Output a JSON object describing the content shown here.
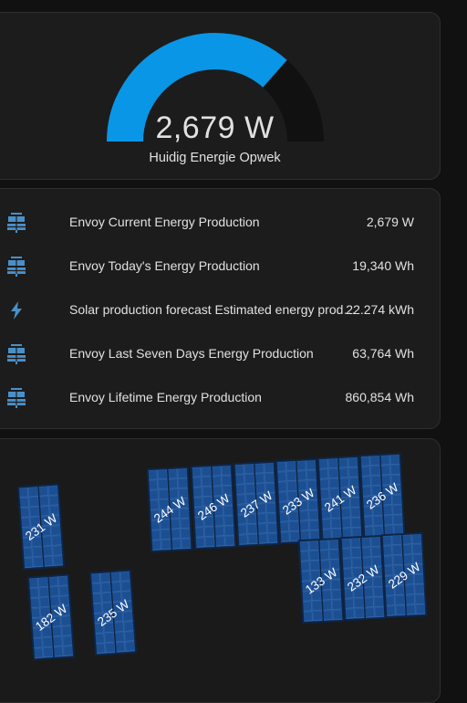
{
  "gauge": {
    "value": "2,679 W",
    "label": "Huidig Energie Opwek",
    "fill_fraction": 0.73,
    "color": "#0996e6",
    "track_color": "#111111"
  },
  "entities": [
    {
      "icon": "solar-power-icon",
      "name": "Envoy Current Energy Production",
      "value": "2,679 W"
    },
    {
      "icon": "solar-power-icon",
      "name": "Envoy Today's Energy Production",
      "value": "19,340 Wh"
    },
    {
      "icon": "flash-icon",
      "name": "Solar production forecast Estimated energy production - this hour",
      "value": "22.274 kWh"
    },
    {
      "icon": "solar-power-icon",
      "name": "Envoy Last Seven Days Energy Production",
      "value": "63,764 Wh"
    },
    {
      "icon": "solar-power-icon",
      "name": "Envoy Lifetime Energy Production",
      "value": "860,854 Wh"
    }
  ],
  "icon_color": "#4a90c8",
  "panels": [
    {
      "value": "231 W"
    },
    {
      "value": "182 W"
    },
    {
      "value": "235 W"
    },
    {
      "value": "244 W"
    },
    {
      "value": "246 W"
    },
    {
      "value": "237 W"
    },
    {
      "value": "233 W"
    },
    {
      "value": "241 W"
    },
    {
      "value": "236 W"
    },
    {
      "value": "133 W"
    },
    {
      "value": "232 W"
    },
    {
      "value": "229 W"
    }
  ]
}
